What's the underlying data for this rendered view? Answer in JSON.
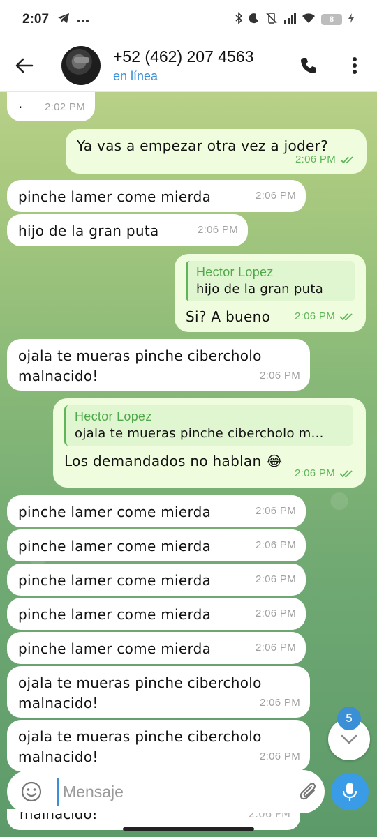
{
  "status_bar": {
    "time": "2:07",
    "left_icons": [
      "telegram-icon",
      "more-dots-icon"
    ],
    "right_icons": [
      "bluetooth-icon",
      "do-not-disturb-icon",
      "vibrate-off-icon",
      "signal-icon",
      "wifi-icon"
    ],
    "battery_level": "8"
  },
  "header": {
    "contact_name": "+52 (462) 207 4563",
    "status": "en línea"
  },
  "messages": [
    {
      "dir": "in",
      "text": "·",
      "time": "2:02 PM"
    },
    {
      "dir": "out",
      "text": "Ya vas a empezar otra vez a joder?",
      "time": "2:06 PM"
    },
    {
      "dir": "in",
      "text": "pinche lamer come mierda",
      "time": "2:06 PM"
    },
    {
      "dir": "in",
      "text": "hijo de la gran puta",
      "time": "2:06 PM"
    },
    {
      "dir": "out",
      "reply_name": "Hector Lopez",
      "reply_text": "hijo de la gran puta",
      "text": "Si? A bueno",
      "time": "2:06 PM"
    },
    {
      "dir": "in",
      "text": "ojala te mueras pinche cibercholo malnacido!",
      "time": "2:06 PM"
    },
    {
      "dir": "out",
      "reply_name": "Hector Lopez",
      "reply_text": "ojala te mueras pinche cibercholo m...",
      "text": "Los demandados no hablan 😂",
      "time": "2:06 PM"
    },
    {
      "dir": "in",
      "text": "pinche lamer come mierda",
      "time": "2:06 PM"
    },
    {
      "dir": "in",
      "text": "pinche lamer come mierda",
      "time": "2:06 PM"
    },
    {
      "dir": "in",
      "text": "pinche lamer come mierda",
      "time": "2:06 PM"
    },
    {
      "dir": "in",
      "text": "pinche lamer come mierda",
      "time": "2:06 PM"
    },
    {
      "dir": "in",
      "text": "pinche lamer come mierda",
      "time": "2:06 PM"
    },
    {
      "dir": "in",
      "text": "ojala te mueras pinche cibercholo malnacido!",
      "time": "2:06 PM"
    },
    {
      "dir": "in",
      "text": "ojala te mueras pinche cibercholo malnacido!",
      "time": "2:06 PM"
    },
    {
      "dir": "in",
      "text": "malnacido!",
      "time": "2:06 PM"
    }
  ],
  "scroll_down": {
    "unread_count": "5"
  },
  "input": {
    "placeholder": "Mensaje"
  },
  "colors": {
    "outgoing_bubble": "#effdde",
    "incoming_bubble": "#ffffff",
    "accent": "#3a8fd6",
    "check_green": "#5fb65a"
  }
}
